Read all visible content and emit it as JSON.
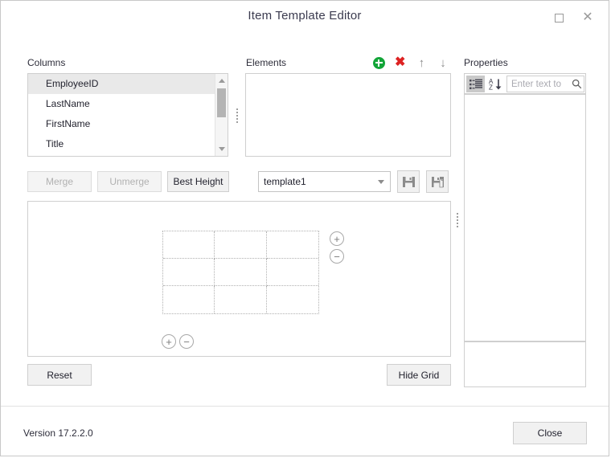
{
  "window": {
    "title": "Item Template Editor",
    "maximize_icon": "maximize-icon",
    "close_icon": "close-icon"
  },
  "columns_panel": {
    "label": "Columns",
    "items": [
      {
        "label": "EmployeeID",
        "selected": true
      },
      {
        "label": "LastName",
        "selected": false
      },
      {
        "label": "FirstName",
        "selected": false
      },
      {
        "label": "Title",
        "selected": false
      }
    ],
    "scroll_up_icon": "scroll-up-arrow-icon",
    "scroll_down_icon": "scroll-down-arrow-icon"
  },
  "elements_panel": {
    "label": "Elements",
    "items": [],
    "toolbar": {
      "add_icon": "add-circle-icon",
      "delete_icon": "delete-x-icon",
      "move_up_icon": "arrow-up-icon",
      "move_down_icon": "arrow-down-icon",
      "add_color": "#13a538",
      "delete_color": "#dd2222"
    }
  },
  "properties_panel": {
    "label": "Properties",
    "toolbar": {
      "categorized_icon": "categorized-view-icon",
      "alphabetical_icon": "alphabetical-sort-icon",
      "search_placeholder": "Enter text to",
      "search_value": "",
      "search_icon": "search-icon"
    },
    "rows": [],
    "description": ""
  },
  "edit_toolbar": {
    "merge_label": "Merge",
    "merge_enabled": false,
    "unmerge_label": "Unmerge",
    "unmerge_enabled": false,
    "best_height_label": "Best Height",
    "best_height_enabled": true,
    "template_selected": "template1",
    "template_options": [
      "template1"
    ],
    "dropdown_icon": "chevron-down-icon",
    "save_icon": "save-floppy-icon",
    "save_as_icon": "save-as-floppy-icon"
  },
  "design_area": {
    "grid": {
      "rows": 3,
      "columns": 3,
      "visible": true
    },
    "row_add_label": "+",
    "row_remove_label": "−",
    "column_add_label": "+",
    "column_remove_label": "−"
  },
  "bottom_bar": {
    "reset_label": "Reset",
    "hide_grid_label": "Hide Grid"
  },
  "footer": {
    "version": "Version 17.2.2.0",
    "close_label": "Close"
  }
}
